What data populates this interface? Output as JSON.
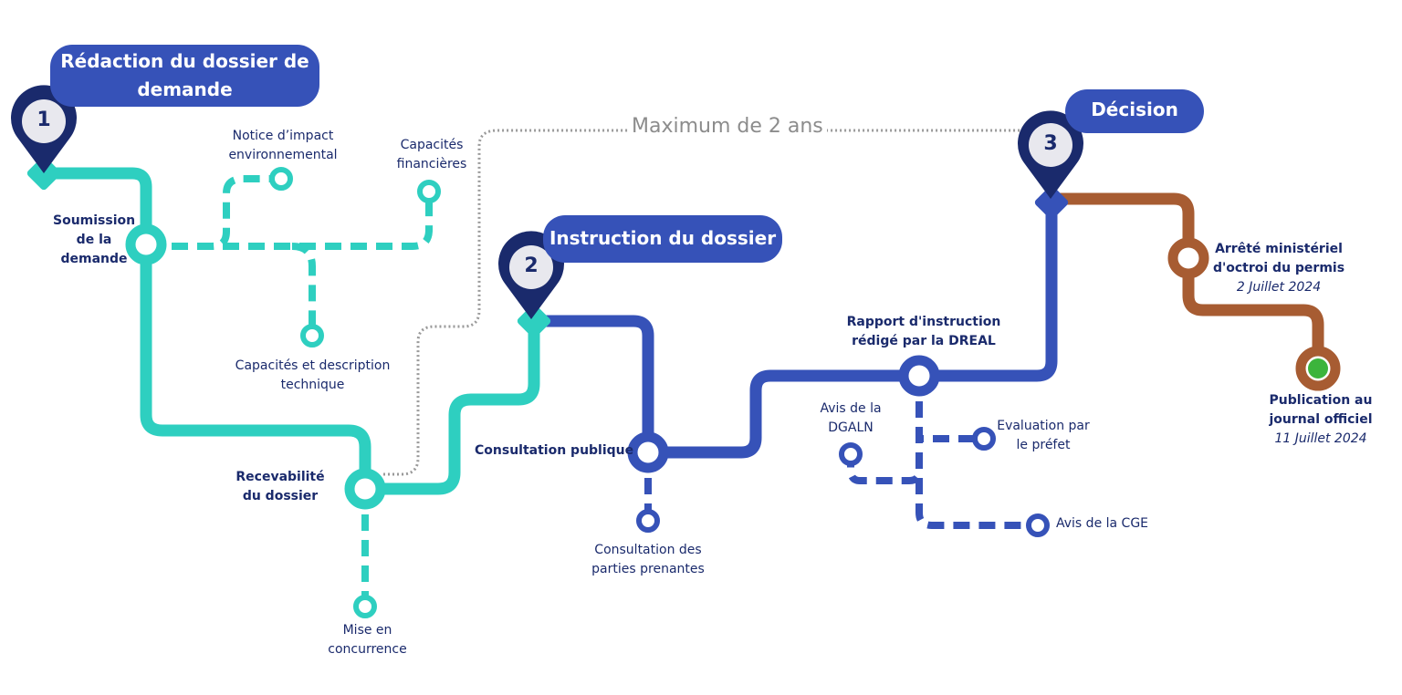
{
  "colors": {
    "phase1": "#2ecfc0",
    "phase2": "#3652b8",
    "phase3": "#a75c32",
    "pin": "#1a2a6c",
    "pin_face": "#e8e8ee",
    "label_text": "#1a2a6c",
    "duration_line": "#9a9a9a",
    "final_dot": "#3cb43c"
  },
  "duration_label": "Maximum de 2 ans",
  "phases": [
    {
      "number": "1",
      "title": "Rédaction du dossier de demande"
    },
    {
      "number": "2",
      "title": "Instruction du dossier"
    },
    {
      "number": "3",
      "title": "Décision"
    }
  ],
  "stations": {
    "soumission": "Soumission de la demande",
    "notice": "Notice d’impact environnemental",
    "capacites_fin": "Capacités financières",
    "capacites_tech": "Capacités et description technique",
    "recevabilite": "Recevabilité du dossier",
    "mise_concurrence": "Mise en concurrence",
    "consultation_publique": "Consultation publique",
    "consultation_parties": "Consultation des parties prenantes",
    "rapport": "Rapport d'instruction rédigé par la DREAL",
    "avis_dgaln": "Avis de la DGALN",
    "evaluation": "Evaluation par le préfet",
    "avis_cge": "Avis de la CGE",
    "arrete": "Arrêté ministériel d'octroi du permis",
    "arrete_date": "2 Juillet 2024",
    "publication": "Publication au journal officiel",
    "publication_date": "11 Juillet 2024"
  }
}
